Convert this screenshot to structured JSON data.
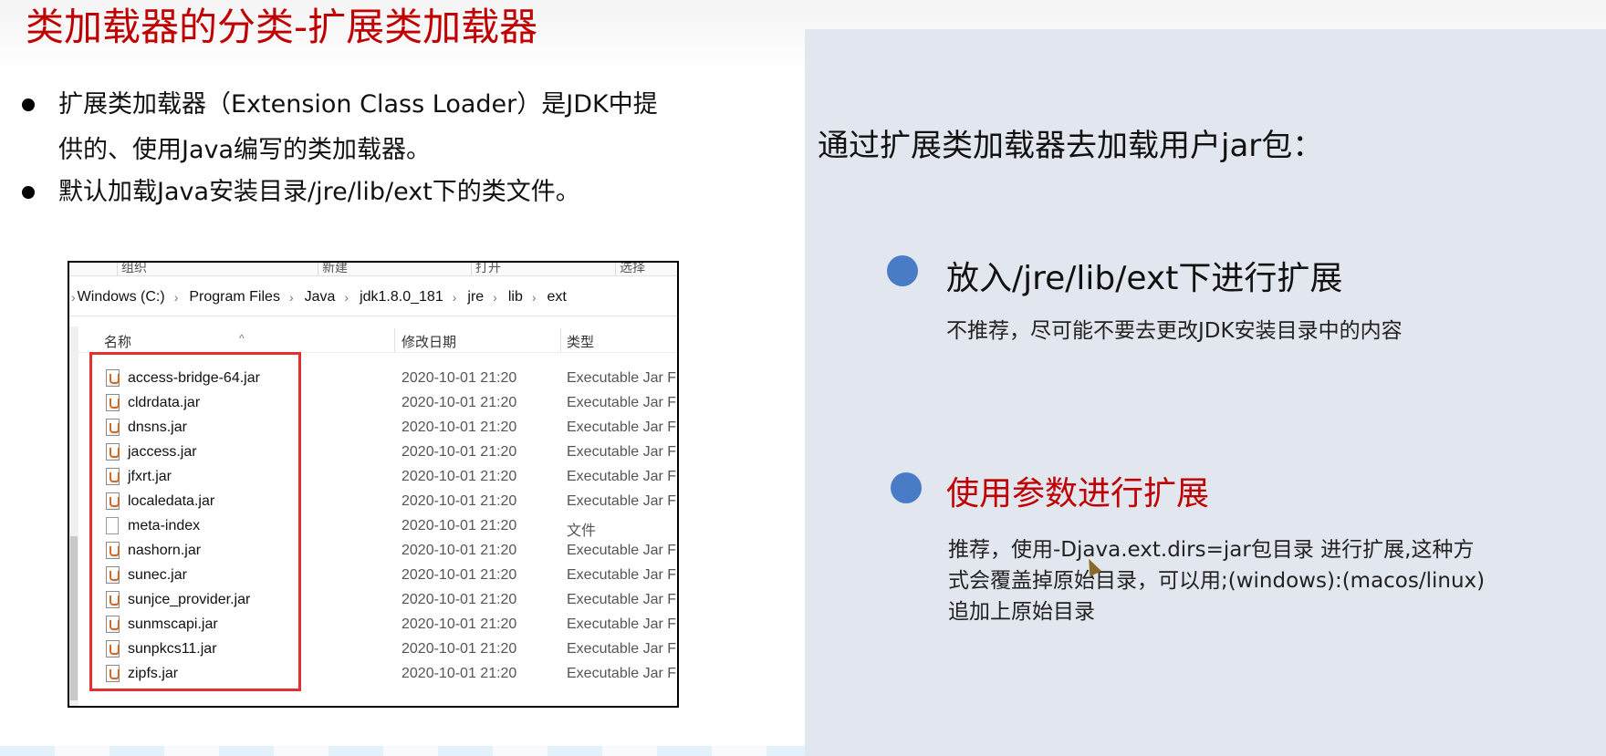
{
  "slide": {
    "title": "类加载器的分类-扩展类加载器",
    "bullets": [
      "扩展类加载器（Extension Class Loader）是JDK中提供的、使用Java编写的类加载器。",
      "默认加载Java安装目录/jre/lib/ext下的类文件。"
    ]
  },
  "explorer": {
    "ribbon": [
      "组织",
      "新建",
      "打开",
      "选择"
    ],
    "path": [
      "Windows (C:)",
      "Program Files",
      "Java",
      "jdk1.8.0_181",
      "jre",
      "lib",
      "ext"
    ],
    "columns": [
      "名称",
      "修改日期",
      "类型"
    ],
    "files": [
      {
        "name": "access-bridge-64.jar",
        "date": "2020-10-01 21:20",
        "type": "Executable Jar Fi",
        "icon": "jar-file-icon"
      },
      {
        "name": "cldrdata.jar",
        "date": "2020-10-01 21:20",
        "type": "Executable Jar Fi",
        "icon": "jar-file-icon"
      },
      {
        "name": "dnsns.jar",
        "date": "2020-10-01 21:20",
        "type": "Executable Jar Fi",
        "icon": "jar-file-icon"
      },
      {
        "name": "jaccess.jar",
        "date": "2020-10-01 21:20",
        "type": "Executable Jar Fi",
        "icon": "jar-file-icon"
      },
      {
        "name": "jfxrt.jar",
        "date": "2020-10-01 21:20",
        "type": "Executable Jar Fi",
        "icon": "jar-file-icon"
      },
      {
        "name": "localedata.jar",
        "date": "2020-10-01 21:20",
        "type": "Executable Jar Fi",
        "icon": "jar-file-icon"
      },
      {
        "name": "meta-index",
        "date": "2020-10-01 21:20",
        "type": "文件",
        "icon": "file-icon"
      },
      {
        "name": "nashorn.jar",
        "date": "2020-10-01 21:20",
        "type": "Executable Jar Fi",
        "icon": "jar-file-icon"
      },
      {
        "name": "sunec.jar",
        "date": "2020-10-01 21:20",
        "type": "Executable Jar Fi",
        "icon": "jar-file-icon"
      },
      {
        "name": "sunjce_provider.jar",
        "date": "2020-10-01 21:20",
        "type": "Executable Jar Fi",
        "icon": "jar-file-icon"
      },
      {
        "name": "sunmscapi.jar",
        "date": "2020-10-01 21:20",
        "type": "Executable Jar Fi",
        "icon": "jar-file-icon"
      },
      {
        "name": "sunpkcs11.jar",
        "date": "2020-10-01 21:20",
        "type": "Executable Jar Fi",
        "icon": "jar-file-icon"
      },
      {
        "name": "zipfs.jar",
        "date": "2020-10-01 21:20",
        "type": "Executable Jar Fi",
        "icon": "jar-file-icon"
      }
    ]
  },
  "right": {
    "heading": "通过扩展类加载器去加载用户jar包：",
    "items": [
      {
        "title": "放入/jre/lib/ext下进行扩展",
        "note_lines": [
          "不推荐，尽可能不要去更改JDK安装目录中的内容"
        ],
        "title_color": "#111111"
      },
      {
        "title": "使用参数进行扩展",
        "note_lines": [
          "推荐，使用-Djava.ext.dirs=jar包目录 进行扩展,这种方",
          "式会覆盖掉原始目录，可以用;(windows):(macos/linux)",
          "追加上原始目录"
        ],
        "title_color": "#c00000"
      }
    ]
  },
  "colors": {
    "title_red": "#c00000",
    "highlight_red": "#e03030",
    "panel_bg": "#e2e6ee",
    "bullet_blue": "#4a7bc7"
  }
}
